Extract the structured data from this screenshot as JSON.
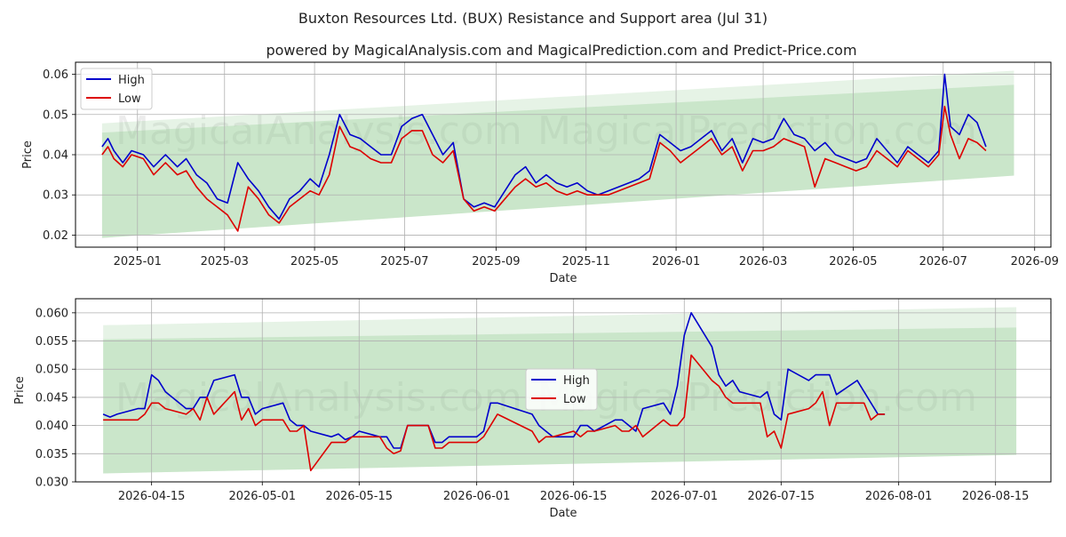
{
  "title": "Buxton Resources Ltd. (BUX) Resistance and Support area (Jul 31)",
  "subtitle": "powered by MagicalAnalysis.com and MagicalPrediction.com and Predict-Price.com",
  "watermark": [
    "MagicalAnalysis.com",
    "MagicalPrediction.com"
  ],
  "colors": {
    "high": "#0000cc",
    "low": "#dd0000",
    "band": "#8fc98f"
  },
  "chart_data": [
    {
      "type": "line",
      "id": "top",
      "xlabel": "Date",
      "ylabel": "Price",
      "xlim": [
        "2024-11-20",
        "2026-09-12"
      ],
      "ylim": [
        0.017,
        0.063
      ],
      "xticks": [
        "2025-01-01",
        "2025-03-01",
        "2025-05-01",
        "2025-07-01",
        "2025-09-01",
        "2025-11-01",
        "2026-01-01",
        "2026-03-01",
        "2026-05-01",
        "2026-07-01",
        "2026-09-01"
      ],
      "xtick_labels": [
        "2025-01",
        "2025-03",
        "2025-05",
        "2025-07",
        "2025-09",
        "2025-11",
        "2026-01",
        "2026-03",
        "2026-05",
        "2026-07",
        "2026-09"
      ],
      "yticks": [
        0.02,
        0.03,
        0.04,
        0.05,
        0.06
      ],
      "ytick_labels": [
        "0.02",
        "0.03",
        "0.04",
        "0.05",
        "0.06"
      ],
      "legend": {
        "position": "top-left",
        "entries": [
          "High",
          "Low"
        ]
      },
      "bands": [
        {
          "name": "resistance-support-outer",
          "x": [
            "2024-12-08",
            "2026-08-18"
          ],
          "upper": [
            0.0478,
            0.0609
          ],
          "lower": [
            0.0193,
            0.0348
          ],
          "opacity": 0.22
        },
        {
          "name": "resistance-support-inner",
          "x": [
            "2024-12-08",
            "2026-08-18"
          ],
          "upper": [
            0.0455,
            0.0574
          ],
          "lower": [
            0.0193,
            0.0348
          ],
          "opacity": 0.32
        }
      ],
      "series": [
        {
          "name": "High",
          "x": [
            "2024-12-08",
            "2024-12-12",
            "2024-12-16",
            "2024-12-22",
            "2024-12-28",
            "2025-01-05",
            "2025-01-12",
            "2025-01-20",
            "2025-01-28",
            "2025-02-03",
            "2025-02-10",
            "2025-02-17",
            "2025-02-24",
            "2025-03-03",
            "2025-03-10",
            "2025-03-17",
            "2025-03-24",
            "2025-03-31",
            "2025-04-07",
            "2025-04-14",
            "2025-04-21",
            "2025-04-28",
            "2025-05-04",
            "2025-05-11",
            "2025-05-18",
            "2025-05-25",
            "2025-06-01",
            "2025-06-08",
            "2025-06-15",
            "2025-06-22",
            "2025-06-29",
            "2025-07-06",
            "2025-07-13",
            "2025-07-20",
            "2025-07-27",
            "2025-08-03",
            "2025-08-10",
            "2025-08-17",
            "2025-08-24",
            "2025-08-31",
            "2025-09-07",
            "2025-09-14",
            "2025-09-21",
            "2025-09-28",
            "2025-10-05",
            "2025-10-12",
            "2025-10-19",
            "2025-10-26",
            "2025-11-02",
            "2025-11-09",
            "2025-11-16",
            "2025-11-23",
            "2025-11-30",
            "2025-12-07",
            "2025-12-14",
            "2025-12-21",
            "2025-12-28",
            "2026-01-04",
            "2026-01-11",
            "2026-01-18",
            "2026-01-25",
            "2026-02-01",
            "2026-02-08",
            "2026-02-15",
            "2026-02-22",
            "2026-03-01",
            "2026-03-08",
            "2026-03-15",
            "2026-03-22",
            "2026-03-29",
            "2026-04-05",
            "2026-04-12",
            "2026-04-19",
            "2026-04-26",
            "2026-05-03",
            "2026-05-10",
            "2026-05-17",
            "2026-05-24",
            "2026-05-31",
            "2026-06-07",
            "2026-06-14",
            "2026-06-21",
            "2026-06-28",
            "2026-07-02",
            "2026-07-06",
            "2026-07-12",
            "2026-07-18",
            "2026-07-24",
            "2026-07-30"
          ],
          "values": [
            0.042,
            0.044,
            0.041,
            0.038,
            0.041,
            0.04,
            0.037,
            0.04,
            0.037,
            0.039,
            0.035,
            0.033,
            0.029,
            0.028,
            0.038,
            0.034,
            0.031,
            0.027,
            0.024,
            0.029,
            0.031,
            0.034,
            0.032,
            0.04,
            0.05,
            0.045,
            0.044,
            0.042,
            0.04,
            0.04,
            0.047,
            0.049,
            0.05,
            0.045,
            0.04,
            0.043,
            0.029,
            0.027,
            0.028,
            0.027,
            0.031,
            0.035,
            0.037,
            0.033,
            0.035,
            0.033,
            0.032,
            0.033,
            0.031,
            0.03,
            0.031,
            0.032,
            0.033,
            0.034,
            0.036,
            0.045,
            0.043,
            0.041,
            0.042,
            0.044,
            0.046,
            0.041,
            0.044,
            0.038,
            0.044,
            0.043,
            0.044,
            0.049,
            0.045,
            0.044,
            0.041,
            0.043,
            0.04,
            0.039,
            0.038,
            0.039,
            0.044,
            0.041,
            0.038,
            0.042,
            0.04,
            0.038,
            0.041,
            0.06,
            0.047,
            0.045,
            0.05,
            0.048,
            0.042
          ]
        },
        {
          "name": "Low",
          "x": [
            "2024-12-08",
            "2024-12-12",
            "2024-12-16",
            "2024-12-22",
            "2024-12-28",
            "2025-01-05",
            "2025-01-12",
            "2025-01-20",
            "2025-01-28",
            "2025-02-03",
            "2025-02-10",
            "2025-02-17",
            "2025-02-24",
            "2025-03-03",
            "2025-03-10",
            "2025-03-17",
            "2025-03-24",
            "2025-03-31",
            "2025-04-07",
            "2025-04-14",
            "2025-04-21",
            "2025-04-28",
            "2025-05-04",
            "2025-05-11",
            "2025-05-18",
            "2025-05-25",
            "2025-06-01",
            "2025-06-08",
            "2025-06-15",
            "2025-06-22",
            "2025-06-29",
            "2025-07-06",
            "2025-07-13",
            "2025-07-20",
            "2025-07-27",
            "2025-08-03",
            "2025-08-10",
            "2025-08-17",
            "2025-08-24",
            "2025-08-31",
            "2025-09-07",
            "2025-09-14",
            "2025-09-21",
            "2025-09-28",
            "2025-10-05",
            "2025-10-12",
            "2025-10-19",
            "2025-10-26",
            "2025-11-02",
            "2025-11-09",
            "2025-11-16",
            "2025-11-23",
            "2025-11-30",
            "2025-12-07",
            "2025-12-14",
            "2025-12-21",
            "2025-12-28",
            "2026-01-04",
            "2026-01-11",
            "2026-01-18",
            "2026-01-25",
            "2026-02-01",
            "2026-02-08",
            "2026-02-15",
            "2026-02-22",
            "2026-03-01",
            "2026-03-08",
            "2026-03-15",
            "2026-03-22",
            "2026-03-29",
            "2026-04-05",
            "2026-04-12",
            "2026-04-19",
            "2026-04-26",
            "2026-05-03",
            "2026-05-10",
            "2026-05-17",
            "2026-05-24",
            "2026-05-31",
            "2026-06-07",
            "2026-06-14",
            "2026-06-21",
            "2026-06-28",
            "2026-07-02",
            "2026-07-06",
            "2026-07-12",
            "2026-07-18",
            "2026-07-24",
            "2026-07-30"
          ],
          "values": [
            0.04,
            0.042,
            0.039,
            0.037,
            0.04,
            0.039,
            0.035,
            0.038,
            0.035,
            0.036,
            0.032,
            0.029,
            0.027,
            0.025,
            0.021,
            0.032,
            0.029,
            0.025,
            0.023,
            0.027,
            0.029,
            0.031,
            0.03,
            0.035,
            0.047,
            0.042,
            0.041,
            0.039,
            0.038,
            0.038,
            0.044,
            0.046,
            0.046,
            0.04,
            0.038,
            0.041,
            0.029,
            0.026,
            0.027,
            0.026,
            0.029,
            0.032,
            0.034,
            0.032,
            0.033,
            0.031,
            0.03,
            0.031,
            0.03,
            0.03,
            0.03,
            0.031,
            0.032,
            0.033,
            0.034,
            0.043,
            0.041,
            0.038,
            0.04,
            0.042,
            0.044,
            0.04,
            0.042,
            0.036,
            0.041,
            0.041,
            0.042,
            0.044,
            0.043,
            0.042,
            0.032,
            0.039,
            0.038,
            0.037,
            0.036,
            0.037,
            0.041,
            0.039,
            0.037,
            0.041,
            0.039,
            0.037,
            0.04,
            0.052,
            0.045,
            0.039,
            0.044,
            0.043,
            0.041
          ]
        }
      ]
    },
    {
      "type": "line",
      "id": "bottom",
      "xlabel": "Date",
      "ylabel": "Price",
      "xlim": [
        "2026-04-04",
        "2026-08-23"
      ],
      "ylim": [
        0.03,
        0.0625
      ],
      "xticks": [
        "2026-04-15",
        "2026-05-01",
        "2026-05-15",
        "2026-06-01",
        "2026-06-15",
        "2026-07-01",
        "2026-07-15",
        "2026-08-01",
        "2026-08-15"
      ],
      "xtick_labels": [
        "2026-04-15",
        "2026-05-01",
        "2026-05-15",
        "2026-06-01",
        "2026-06-15",
        "2026-07-01",
        "2026-07-15",
        "2026-08-01",
        "2026-08-15"
      ],
      "yticks": [
        0.03,
        0.035,
        0.04,
        0.045,
        0.05,
        0.055,
        0.06
      ],
      "ytick_labels": [
        "0.030",
        "0.035",
        "0.040",
        "0.045",
        "0.050",
        "0.055",
        "0.060"
      ],
      "legend": {
        "position": "center",
        "entries": [
          "High",
          "Low"
        ]
      },
      "bands": [
        {
          "name": "resistance-support-outer",
          "x": [
            "2026-04-08",
            "2026-08-18"
          ],
          "upper": [
            0.0578,
            0.061
          ],
          "lower": [
            0.0315,
            0.0348
          ],
          "opacity": 0.22
        },
        {
          "name": "resistance-support-inner",
          "x": [
            "2026-04-08",
            "2026-08-18"
          ],
          "upper": [
            0.0553,
            0.0574
          ],
          "lower": [
            0.0315,
            0.0348
          ],
          "opacity": 0.32
        }
      ],
      "series": [
        {
          "name": "High",
          "x": [
            "2026-04-08",
            "2026-04-09",
            "2026-04-10",
            "2026-04-13",
            "2026-04-14",
            "2026-04-15",
            "2026-04-16",
            "2026-04-17",
            "2026-04-20",
            "2026-04-21",
            "2026-04-22",
            "2026-04-23",
            "2026-04-24",
            "2026-04-27",
            "2026-04-28",
            "2026-04-29",
            "2026-04-30",
            "2026-05-01",
            "2026-05-04",
            "2026-05-05",
            "2026-05-06",
            "2026-05-07",
            "2026-05-08",
            "2026-05-11",
            "2026-05-12",
            "2026-05-13",
            "2026-05-14",
            "2026-05-15",
            "2026-05-18",
            "2026-05-19",
            "2026-05-20",
            "2026-05-21",
            "2026-05-22",
            "2026-05-25",
            "2026-05-26",
            "2026-05-27",
            "2026-05-28",
            "2026-05-29",
            "2026-06-01",
            "2026-06-02",
            "2026-06-03",
            "2026-06-04",
            "2026-06-09",
            "2026-06-10",
            "2026-06-11",
            "2026-06-12",
            "2026-06-15",
            "2026-06-16",
            "2026-06-17",
            "2026-06-18",
            "2026-06-21",
            "2026-06-22",
            "2026-06-23",
            "2026-06-24",
            "2026-06-25",
            "2026-06-28",
            "2026-06-29",
            "2026-06-30",
            "2026-07-01",
            "2026-07-02",
            "2026-07-05",
            "2026-07-06",
            "2026-07-07",
            "2026-07-08",
            "2026-07-09",
            "2026-07-12",
            "2026-07-13",
            "2026-07-14",
            "2026-07-15",
            "2026-07-16",
            "2026-07-19",
            "2026-07-20",
            "2026-07-21",
            "2026-07-22",
            "2026-07-23",
            "2026-07-26",
            "2026-07-27",
            "2026-07-28",
            "2026-07-29",
            "2026-07-30"
          ],
          "values": [
            0.042,
            0.0415,
            0.042,
            0.043,
            0.043,
            0.049,
            0.048,
            0.046,
            0.043,
            0.043,
            0.045,
            0.045,
            0.048,
            0.049,
            0.045,
            0.045,
            0.042,
            0.043,
            0.044,
            0.041,
            0.04,
            0.04,
            0.039,
            0.038,
            0.0385,
            0.0375,
            0.038,
            0.039,
            0.038,
            0.038,
            0.036,
            0.036,
            0.04,
            0.04,
            0.037,
            0.037,
            0.038,
            0.038,
            0.038,
            0.039,
            0.044,
            0.044,
            0.042,
            0.04,
            0.039,
            0.038,
            0.038,
            0.04,
            0.04,
            0.039,
            0.041,
            0.041,
            0.04,
            0.039,
            0.043,
            0.044,
            0.042,
            0.047,
            0.056,
            0.06,
            0.054,
            0.049,
            0.047,
            0.048,
            0.046,
            0.045,
            0.046,
            0.042,
            0.041,
            0.05,
            0.048,
            0.049,
            0.049,
            0.049,
            0.0455,
            0.048,
            0.046,
            0.044,
            0.042,
            0.042
          ]
        },
        {
          "name": "Low",
          "x": [
            "2026-04-08",
            "2026-04-09",
            "2026-04-10",
            "2026-04-13",
            "2026-04-14",
            "2026-04-15",
            "2026-04-16",
            "2026-04-17",
            "2026-04-20",
            "2026-04-21",
            "2026-04-22",
            "2026-04-23",
            "2026-04-24",
            "2026-04-27",
            "2026-04-28",
            "2026-04-29",
            "2026-04-30",
            "2026-05-01",
            "2026-05-04",
            "2026-05-05",
            "2026-05-06",
            "2026-05-07",
            "2026-05-08",
            "2026-05-11",
            "2026-05-12",
            "2026-05-13",
            "2026-05-14",
            "2026-05-15",
            "2026-05-18",
            "2026-05-19",
            "2026-05-20",
            "2026-05-21",
            "2026-05-22",
            "2026-05-25",
            "2026-05-26",
            "2026-05-27",
            "2026-05-28",
            "2026-05-29",
            "2026-06-01",
            "2026-06-02",
            "2026-06-03",
            "2026-06-04",
            "2026-06-09",
            "2026-06-10",
            "2026-06-11",
            "2026-06-12",
            "2026-06-15",
            "2026-06-16",
            "2026-06-17",
            "2026-06-18",
            "2026-06-21",
            "2026-06-22",
            "2026-06-23",
            "2026-06-24",
            "2026-06-25",
            "2026-06-28",
            "2026-06-29",
            "2026-06-30",
            "2026-07-01",
            "2026-07-02",
            "2026-07-05",
            "2026-07-06",
            "2026-07-07",
            "2026-07-08",
            "2026-07-09",
            "2026-07-12",
            "2026-07-13",
            "2026-07-14",
            "2026-07-15",
            "2026-07-16",
            "2026-07-19",
            "2026-07-20",
            "2026-07-21",
            "2026-07-22",
            "2026-07-23",
            "2026-07-26",
            "2026-07-27",
            "2026-07-28",
            "2026-07-29",
            "2026-07-30"
          ],
          "values": [
            0.041,
            0.041,
            0.041,
            0.041,
            0.042,
            0.044,
            0.044,
            0.043,
            0.042,
            0.043,
            0.041,
            0.045,
            0.042,
            0.046,
            0.041,
            0.043,
            0.04,
            0.041,
            0.041,
            0.039,
            0.039,
            0.04,
            0.032,
            0.037,
            0.037,
            0.037,
            0.038,
            0.038,
            0.038,
            0.036,
            0.035,
            0.0355,
            0.04,
            0.04,
            0.036,
            0.036,
            0.037,
            0.037,
            0.037,
            0.038,
            0.04,
            0.042,
            0.039,
            0.037,
            0.038,
            0.038,
            0.039,
            0.038,
            0.039,
            0.039,
            0.04,
            0.039,
            0.039,
            0.04,
            0.038,
            0.041,
            0.04,
            0.04,
            0.0415,
            0.0525,
            0.048,
            0.047,
            0.045,
            0.044,
            0.044,
            0.044,
            0.038,
            0.039,
            0.036,
            0.042,
            0.043,
            0.044,
            0.046,
            0.04,
            0.044,
            0.044,
            0.044,
            0.041,
            0.042,
            0.042
          ]
        }
      ]
    }
  ]
}
